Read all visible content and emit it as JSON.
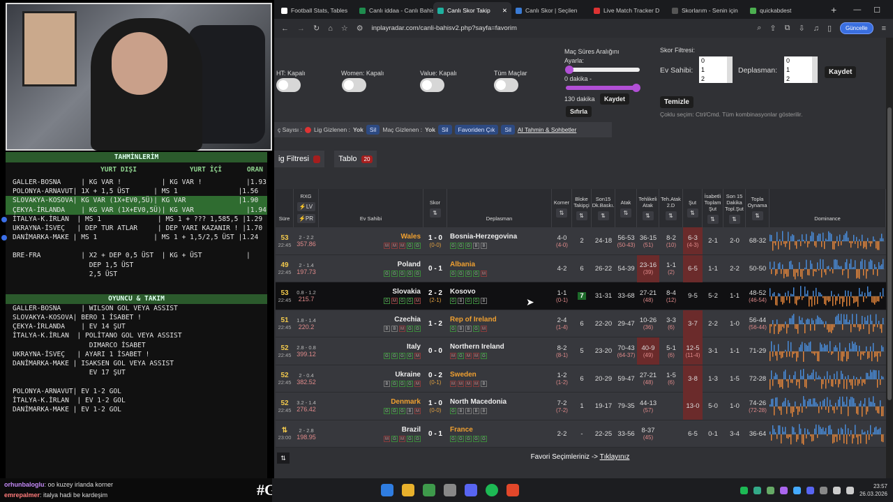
{
  "tabs": [
    {
      "label": "Football Stats, Tables",
      "color": "#ffffff"
    },
    {
      "label": "Canlı iddaa - Canlı Bahis",
      "color": "#1f8c4e"
    },
    {
      "label": "Canlı Skor Takip",
      "color": "#1fb1a0",
      "active": true
    },
    {
      "label": "Canlı Skor | Seçilen",
      "color": "#3a7bd5"
    },
    {
      "label": "Live Match Tracker D",
      "color": "#d33"
    },
    {
      "label": "Skorlarım - Senin için",
      "color": "#555"
    },
    {
      "label": "quickabdest",
      "color": "#4caf50"
    }
  ],
  "address": {
    "url": "inplayradar.com/canli-bahisv2.php?sayfa=favorim",
    "update": "Güncelle"
  },
  "filters": {
    "ht": "HT: Kapalı",
    "women": "Women: Kapalı",
    "value": "Value: Kapalı",
    "all": "Tüm Maçlar",
    "range_title": "Maç Süres Aralığını",
    "range_sub": "Ayarla:",
    "min": "0 dakika -",
    "max": "130 dakika",
    "save": "Kaydet",
    "reset": "Sıfırla",
    "score_title": "Skor Filtresi:",
    "home_label": "Ev Sahibi:",
    "away_label": "Deplasman:",
    "list": [
      "0",
      "1",
      "2"
    ],
    "save2": "Kaydet",
    "clean": "Temizle",
    "hint": "Çoklu seçim: Ctrl/Cmd. Tüm kombinasyonlar gösterilir."
  },
  "infobar": {
    "count": "ç Sayısı :",
    "lig_hidden": "Lig Gizlenen :",
    "yok": "Yok",
    "sil": "Sil",
    "mac_hidden": "Maç Gizlenen :",
    "fav_out": "Favoriden Çık",
    "ai": "AI Tahmin & Sohbetler"
  },
  "subtabs": {
    "filter": "ig Filtresi",
    "table": "Tablo",
    "table_count": "20"
  },
  "headers": {
    "sure": "Süre",
    "rxg": "RXG",
    "lv": "LV",
    "pr": "PR",
    "home": "Ev Sahibi",
    "score": "Skor",
    "away": "Deplasman",
    "korner": "Korner",
    "bloke": "Bloke Takipçi",
    "son15": "Son15 Dk.Baskı.",
    "atak": "Atak",
    "tehlikeli": "Tehlikeli Atak",
    "tehatak": "Teh.Atak 2.D",
    "sut": "Şut",
    "isabetli": "İsabetli Toplam Şut",
    "son15top": "Son 15 Dakika Topl.Şut",
    "topla": "Topla Oynama",
    "dominance": "Dominance"
  },
  "matches": [
    {
      "min": "53",
      "time": "22:45",
      "xg": "2 - 2.2",
      "xv": "357.86",
      "home": "Wales",
      "away": "Bosnia-Herzegovina",
      "score": "1 - 0",
      "ht": "(0-0)",
      "hform": "MMMGG",
      "aform": "GGGBB",
      "korner": "4-0",
      "ksub": "(4-0)",
      "bloke": "2",
      "son15": "24-18",
      "atak": "56-53",
      "asub": "(50-43)",
      "teh": "36-15",
      "tsub": "(51)",
      "teh2": "8-2",
      "t2sub": "(10)",
      "sut": "6-3",
      "ssub": "(4-3)",
      "isa": "2-1",
      "s15": "2-0",
      "top": "68-32",
      "tsub2": ""
    },
    {
      "min": "49",
      "time": "22:45",
      "xg": "2 - 1.4",
      "xv": "197.73",
      "home": "Poland",
      "away": "Albania",
      "score": "0 - 1",
      "ht": "",
      "hform": "GGGGG",
      "aform": "GGGGM",
      "korner": "4-2",
      "ksub": "",
      "bloke": "6",
      "son15": "26-22",
      "atak": "54-39",
      "asub": "",
      "teh": "23-16",
      "tsub": "(39)",
      "teh2": "1-1",
      "t2sub": "(2)",
      "sut": "6-5",
      "ssub": "",
      "isa": "1-1",
      "s15": "2-2",
      "top": "50-50",
      "tsub2": ""
    },
    {
      "min": "53",
      "time": "22:45",
      "xg": "0.8 - 1.2",
      "xv": "215.7",
      "home": "Slovakia",
      "away": "Kosovo",
      "score": "2 - 2",
      "ht": "(2-1)",
      "hform": "GMGGM",
      "aform": "GBGGB",
      "korner": "1-1",
      "ksub": "(0-1)",
      "bloke": "7",
      "son15": "31-31",
      "atak": "33-68",
      "asub": "",
      "teh": "27-21",
      "tsub": "(48)",
      "teh2": "8-4",
      "t2sub": "(12)",
      "sut": "9-5",
      "ssub": "",
      "isa": "5-2",
      "s15": "1-1",
      "top": "48-52",
      "tsub2": "(46-54)"
    },
    {
      "min": "51",
      "time": "22:45",
      "xg": "1.8 - 1.4",
      "xv": "220.2",
      "home": "Czechia",
      "away": "Rep of Ireland",
      "score": "1 - 2",
      "ht": "",
      "hform": "BBMGG",
      "aform": "GBBGM",
      "korner": "2-4",
      "ksub": "(1-4)",
      "bloke": "6",
      "son15": "22-20",
      "atak": "29-47",
      "asub": "",
      "teh": "10-26",
      "tsub": "(36)",
      "teh2": "3-3",
      "t2sub": "(6)",
      "sut": "3-7",
      "ssub": "",
      "isa": "2-2",
      "s15": "1-0",
      "top": "56-44",
      "tsub2": "(56-44)"
    },
    {
      "min": "52",
      "time": "22:45",
      "xg": "2.8 - 0.8",
      "xv": "399.12",
      "home": "Italy",
      "away": "Northern Ireland",
      "score": "0 - 0",
      "ht": "",
      "hform": "GGGGM",
      "aform": "MGMMG",
      "korner": "8-2",
      "ksub": "(8-1)",
      "bloke": "5",
      "son15": "23-20",
      "atak": "70-43",
      "asub": "(64-37)",
      "teh": "40-9",
      "tsub": "(49)",
      "teh2": "5-1",
      "t2sub": "(6)",
      "sut": "12-5",
      "ssub": "(11-4)",
      "isa": "3-1",
      "s15": "1-1",
      "top": "71-29",
      "tsub2": ""
    },
    {
      "min": "52",
      "time": "22:45",
      "xg": "2 - 0.4",
      "xv": "382.52",
      "home": "Ukraine",
      "away": "Sweden",
      "score": "0 - 2",
      "ht": "(0-1)",
      "hform": "BGGGM",
      "aform": "MMMMB",
      "korner": "1-2",
      "ksub": "(1-2)",
      "bloke": "6",
      "son15": "20-29",
      "atak": "59-47",
      "asub": "",
      "teh": "27-21",
      "tsub": "(48)",
      "teh2": "1-5",
      "t2sub": "(6)",
      "sut": "3-8",
      "ssub": "",
      "isa": "1-3",
      "s15": "1-5",
      "top": "72-28",
      "tsub2": ""
    },
    {
      "min": "52",
      "time": "22:45",
      "xg": "3.2 - 1.4",
      "xv": "276.42",
      "home": "Denmark",
      "away": "North Macedonia",
      "score": "1 - 0",
      "ht": "(0-0)",
      "hform": "GGGBM",
      "aform": "GBBBB",
      "korner": "7-2",
      "ksub": "(7-2)",
      "bloke": "1",
      "son15": "19-17",
      "atak": "79-35",
      "asub": "",
      "teh": "44-13",
      "tsub": "(57)",
      "teh2": "",
      "t2sub": "",
      "sut": "13-0",
      "ssub": "",
      "isa": "5-0",
      "s15": "1-0",
      "top": "74-26",
      "tsub2": "(72-28)"
    },
    {
      "min": "",
      "time": "23:00",
      "xg": "2 - 2.8",
      "xv": "198.95",
      "home": "Brazil",
      "away": "France",
      "score": "0 - 1",
      "ht": "",
      "hform": "MGMGG",
      "aform": "GGGGG",
      "korner": "2-2",
      "ksub": "",
      "bloke": "-",
      "son15": "22-25",
      "atak": "33-56",
      "asub": "",
      "teh": "8-37",
      "tsub": "(45)",
      "teh2": "",
      "t2sub": "",
      "sut": "6-5",
      "ssub": "",
      "isa": "0-1",
      "s15": "3-4",
      "top": "36-64",
      "tsub2": ""
    }
  ],
  "footer": {
    "text": "Favori Seçimleriniz ->",
    "link": "Tıklayınız"
  },
  "notes": {
    "title": "TAHMİNLERİM",
    "col1": "YURT DIŞI",
    "col2": "YURT İÇİ",
    "col3": "ORAN",
    "rows": [
      {
        "t": "GALLER-BOSNA     | KG VAR !          | KG VAR !           |1.93",
        "hl": false,
        "dot": false
      },
      {
        "t": "POLONYA-ARNAVUT| 1X + 1,5 ÜST      | MS 1               |1.56",
        "hl": false,
        "dot": false
      },
      {
        "t": "SLOVAKYA-KOSOVA| KG VAR (1X+EV0,5Ü)| KG VAR             |1.90",
        "hl": true,
        "dot": false
      },
      {
        "t": "ÇEKYA-İRLANDA    | KG VAR (1X+EV0,5Ü)| KG VAR             |1.94",
        "hl": true,
        "dot": false
      },
      {
        "t": "İTALYA-K.İRLAN  | MS 1              | MS 1 + ??? 1,585,5 |1.29",
        "hl": false,
        "dot": true
      },
      {
        "t": "UKRAYNA-İSVEÇ   | DEP TUR ATLAR     | DEP YARI KAZANIR ! |1.70",
        "hl": false,
        "dot": false
      },
      {
        "t": "DANİMARKA-MAKE | MS 1              | MS 1 + 1,5/2,5 ÜST |1.24",
        "hl": false,
        "dot": true
      }
    ],
    "extra": [
      "BRE-FRA          | X2 + DEP 0,5 ÜST  | KG + ÜST           |",
      "                   DEP 1,5 ÜST",
      "                   2,5 ÜST"
    ],
    "title2": "OYUNCU & TAKIM",
    "rows2": [
      "GALLER-BOSNA     | WILSON GOL VEYA ASSIST",
      "SLOVAKYA-KOSOVA| BERO 1 İSABET !",
      "ÇEKYA-İRLANDA    | EV 14 ŞUT",
      "İTALYA-K.İRLAN  | POLİTANO GOL VEYA ASSIST",
      "                   DIMARCO İSABET",
      "UKRAYNA-İSVEÇ   | AYARI 1 İSABET !",
      "DANİMARKA-MAKE | ISAKSEN GOL VEYA ASSIST",
      "                   EV 17 ŞUT",
      "",
      "POLONYA-ARNAVUT| EV 1-2 GOL",
      "İTALYA-K.İRLAN  | EV 1-2 GOL",
      "DANİMARKA-MAKE | EV 1-2 GOL"
    ]
  },
  "chat": [
    {
      "user": "orhunbaloglu",
      "msg": ": oo kuzey irlanda korner"
    },
    {
      "user": "emrepalmer",
      "msg": ": italya hadi be kardeşim"
    }
  ],
  "hashtag": "#GollerNerede",
  "clock": {
    "time": "23:57",
    "date": "26.03.2026"
  }
}
